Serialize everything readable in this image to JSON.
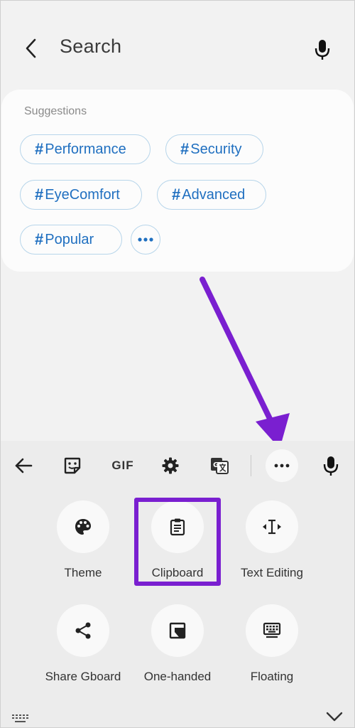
{
  "header": {
    "title": "Search",
    "back_icon": "chevron-left-icon",
    "mic_icon": "mic-icon"
  },
  "suggestions": {
    "label": "Suggestions",
    "chips": [
      {
        "hash": "#",
        "text": "Performance"
      },
      {
        "hash": "#",
        "text": "Security"
      },
      {
        "hash": "#",
        "text": "EyeComfort"
      },
      {
        "hash": "#",
        "text": "Advanced"
      },
      {
        "hash": "#",
        "text": "Popular"
      }
    ],
    "more_icon": "more-horizontal-icon"
  },
  "keyboard": {
    "toolbar": {
      "back_icon": "arrow-left-icon",
      "sticker_icon": "sticker-icon",
      "gif_label": "GIF",
      "settings_icon": "gear-icon",
      "translate_icon": "translate-icon",
      "more_icon": "more-horizontal-icon",
      "mic_icon": "mic-icon"
    },
    "items": [
      {
        "label": "Theme",
        "icon": "palette-icon"
      },
      {
        "label": "Clipboard",
        "icon": "clipboard-icon"
      },
      {
        "label": "Text Editing",
        "icon": "text-cursor-icon"
      },
      {
        "label": "Share Gboard",
        "icon": "share-icon"
      },
      {
        "label": "One-handed",
        "icon": "one-handed-icon"
      },
      {
        "label": "Floating",
        "icon": "floating-keyboard-icon"
      }
    ]
  },
  "colors": {
    "accent_chip_text": "#1f6fc0",
    "chip_border": "#b7d5ea",
    "annotation_purple": "#7a1fd0"
  }
}
